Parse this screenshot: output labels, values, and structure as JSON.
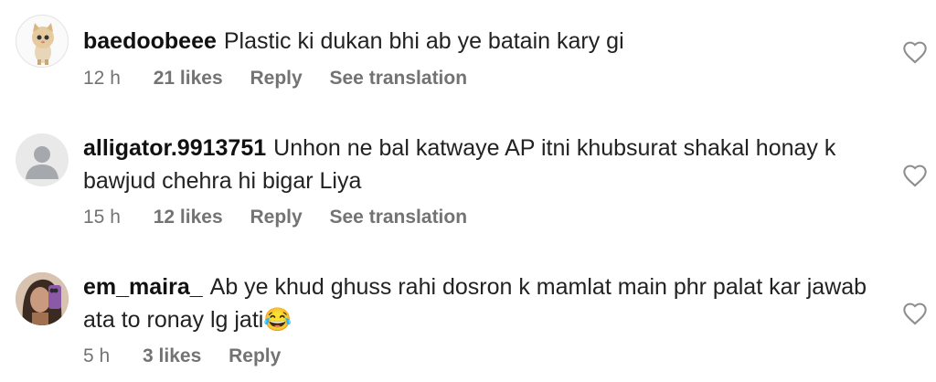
{
  "comments": [
    {
      "username": "baedoobeee",
      "text": "Plastic ki dukan bhi ab ye batain kary gi",
      "time": "12 h",
      "likes": "21 likes",
      "reply": "Reply",
      "translation": "See translation",
      "avatar": "kitten-icon"
    },
    {
      "username": "alligator.9913751",
      "text": "Unhon ne bal katwaye AP itni khubsurat shakal honay k bawjud chehra hi bigar Liya",
      "time": "15 h",
      "likes": "12 likes",
      "reply": "Reply",
      "translation": "See translation",
      "avatar": "default-profile-icon"
    },
    {
      "username": "em_maira_",
      "text": "Ab ye khud ghuss rahi dosron k mamlat main phr palat kar jawab ata to ronay lg jati😂",
      "time": "5 h",
      "likes": "3 likes",
      "reply": "Reply",
      "avatar": "user-photo"
    }
  ],
  "colors": {
    "meta": "#737373",
    "text": "#222222",
    "heart_stroke": "#8e8e8e"
  }
}
